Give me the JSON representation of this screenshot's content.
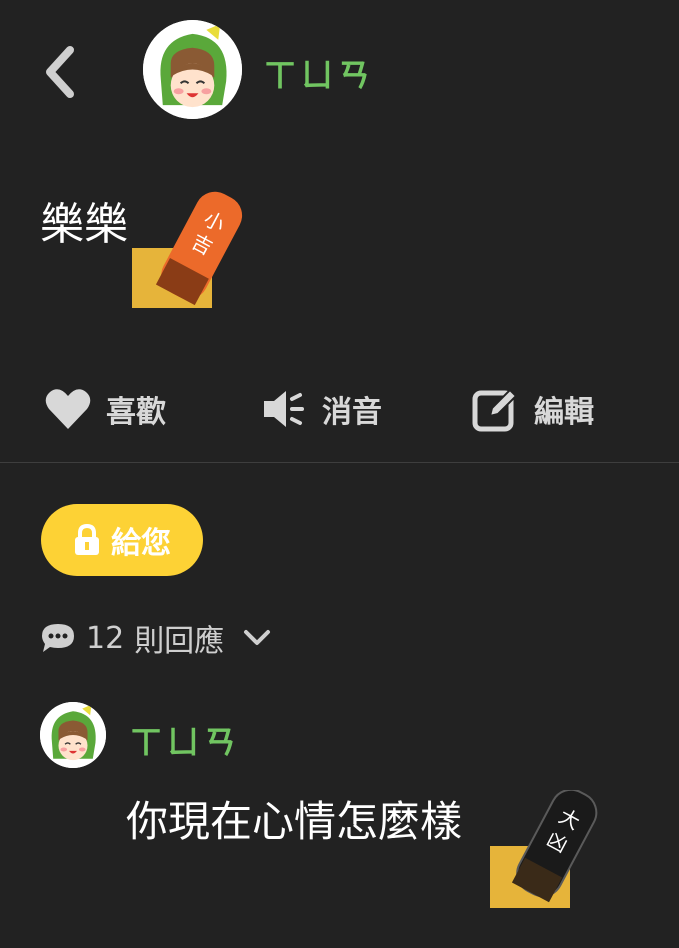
{
  "header": {
    "author_name": "ㄒㄩㄢ"
  },
  "post": {
    "text": "樂樂",
    "sticker_text": "小吉"
  },
  "actions": {
    "like_label": "喜歡",
    "mute_label": "消音",
    "edit_label": "編輯"
  },
  "unlock_button": {
    "label": "給您"
  },
  "replies": {
    "count": "12",
    "label": "則回應"
  },
  "comment": {
    "author_name": "ㄒㄩㄢ",
    "text": "你現在心情怎麼樣",
    "sticker_text": "大凶"
  },
  "colors": {
    "background": "#222222",
    "author_green": "#71c561",
    "unlock_yellow": "#fdd235",
    "lucky_orange": "#ec6a2a",
    "action_gray": "#d8d8d8"
  },
  "icons": [
    "back-arrow-icon",
    "heart-icon",
    "speaker-mute-icon",
    "edit-icon",
    "lock-icon",
    "chat-bubble-icon",
    "chevron-down-icon"
  ]
}
